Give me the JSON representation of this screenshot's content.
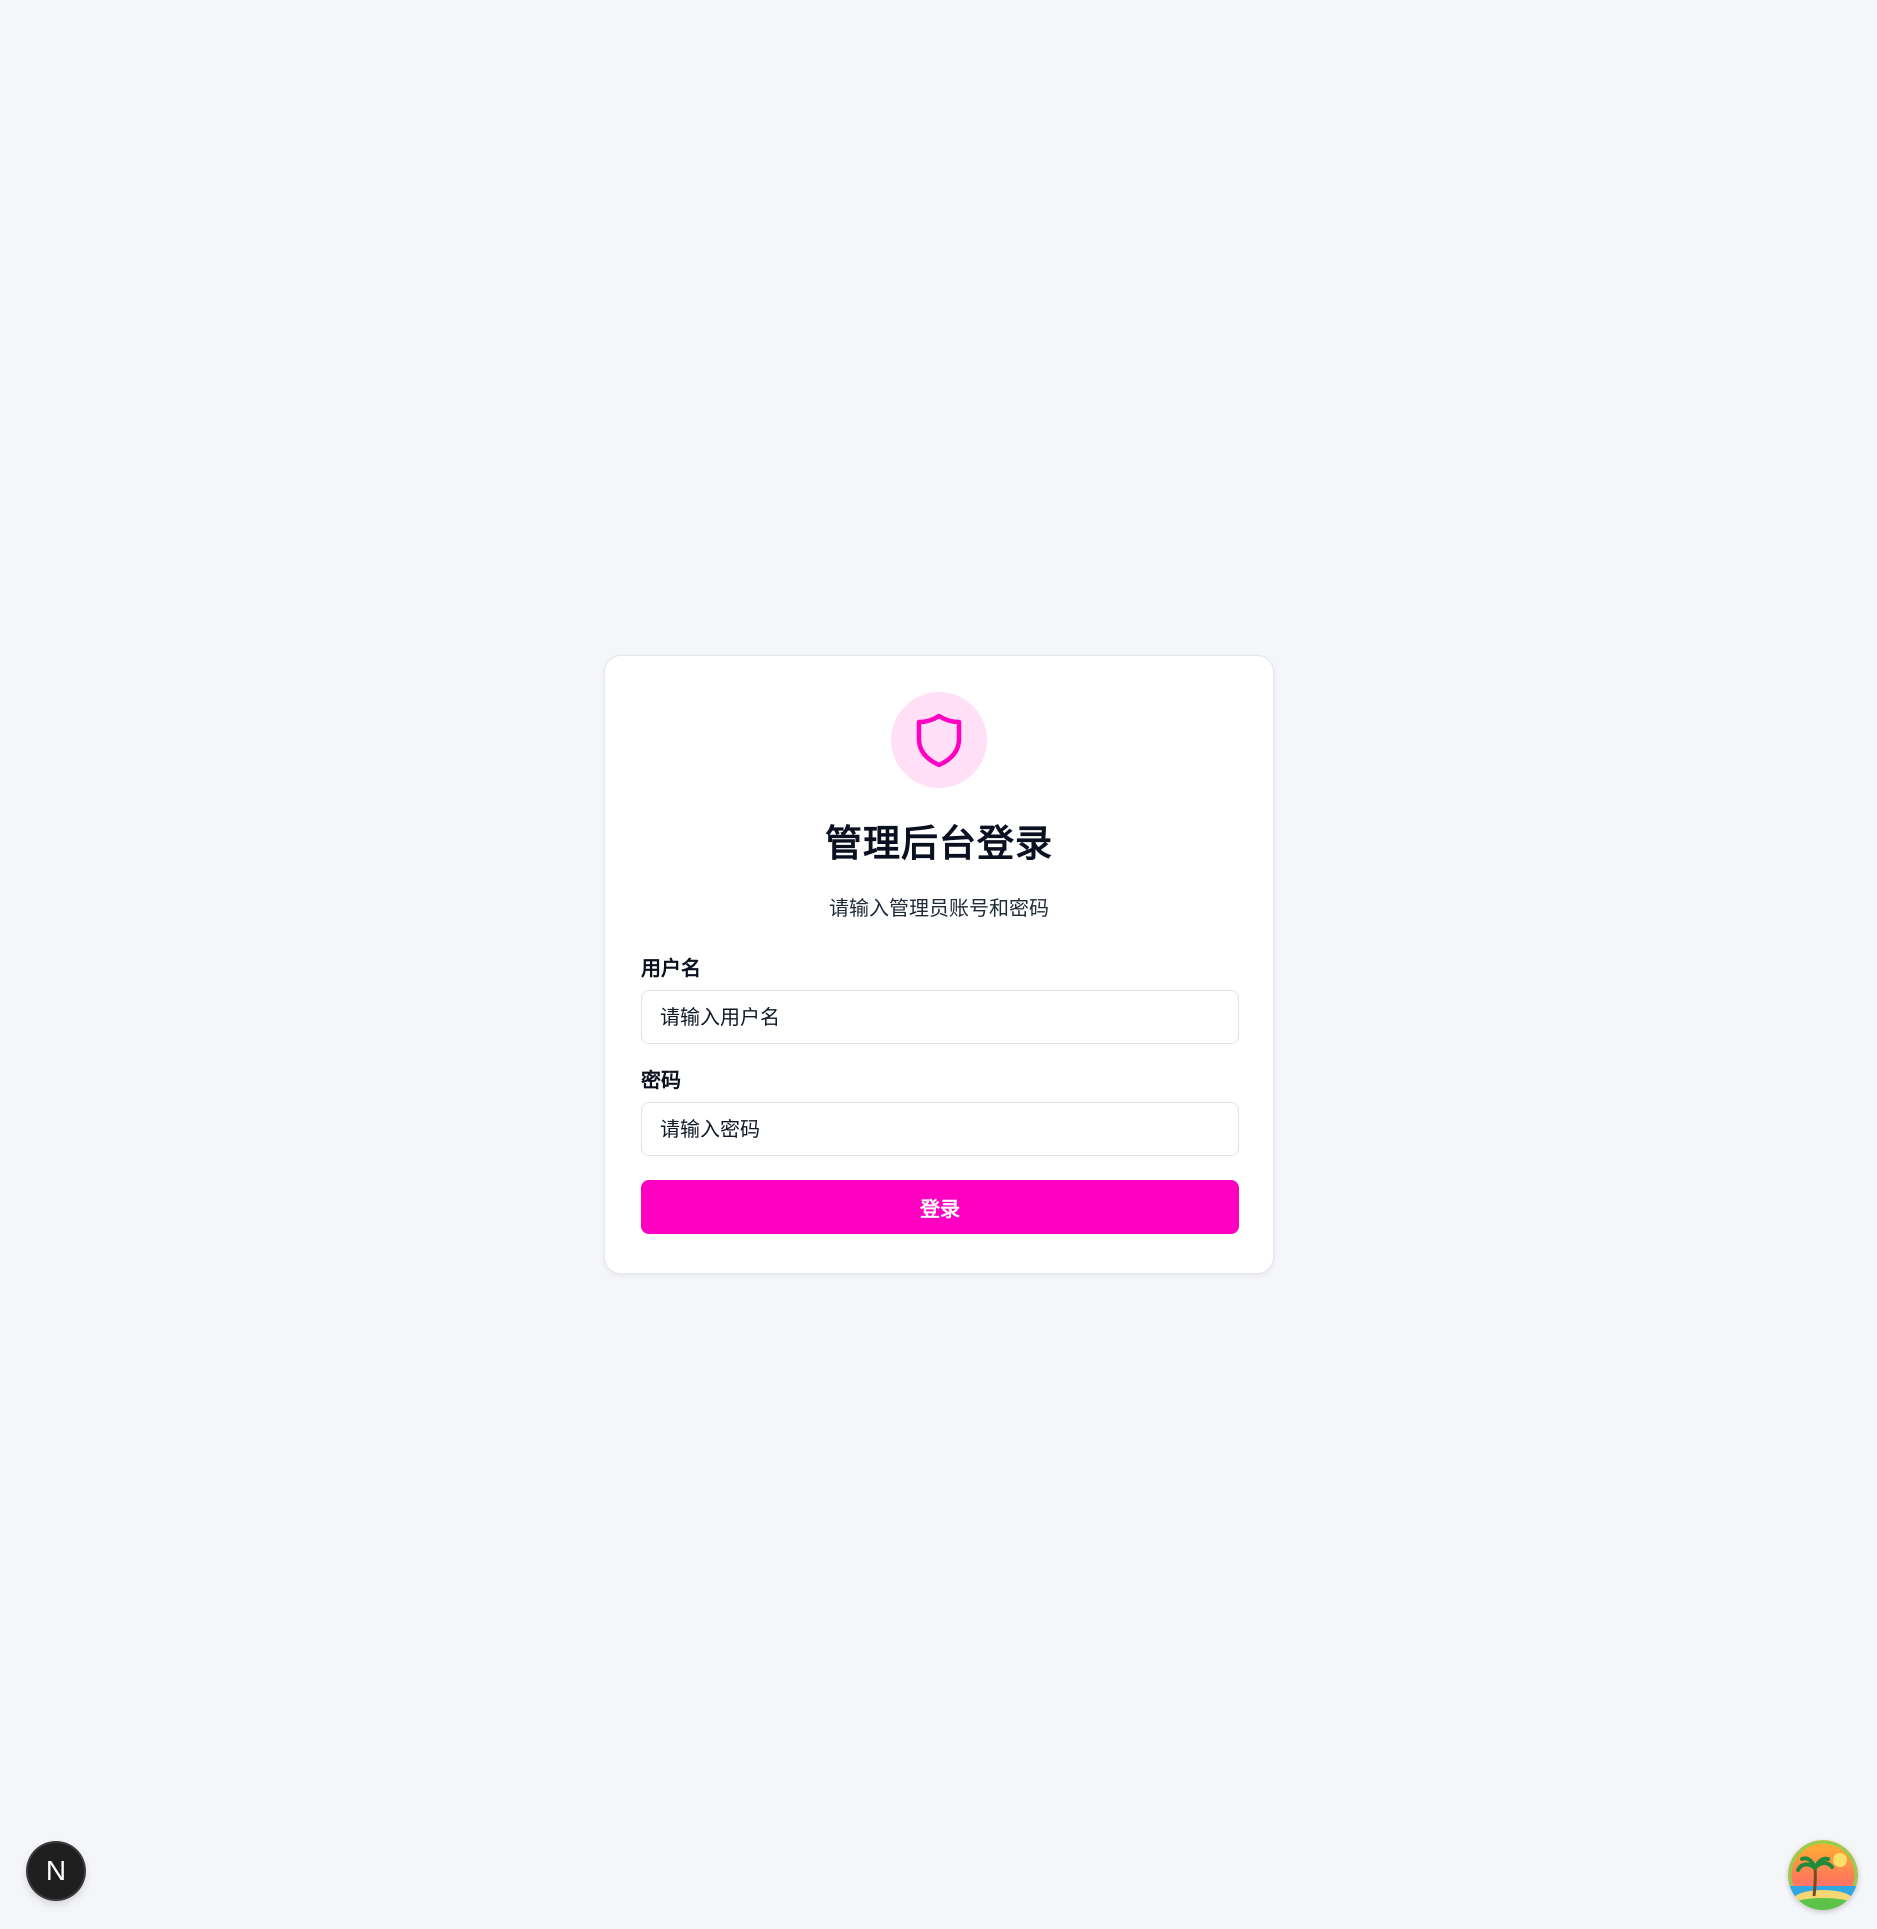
{
  "login": {
    "title": "管理后台登录",
    "subtitle": "请输入管理员账号和密码",
    "username_label": "用户名",
    "username_placeholder": "请输入用户名",
    "password_label": "密码",
    "password_placeholder": "请输入密码",
    "submit_label": "登录"
  },
  "icons": {
    "logo": "shield-icon",
    "dev_badge": "nextjs-icon",
    "corner_badge": "beach-island-icon"
  },
  "dev_badge": {
    "letter": "N"
  },
  "colors": {
    "page_background": "#f5f6fa",
    "card_background": "#ffffff",
    "accent": "#ff00c3",
    "accent_soft": "#ffe0f7",
    "text_primary": "#0b1020"
  }
}
